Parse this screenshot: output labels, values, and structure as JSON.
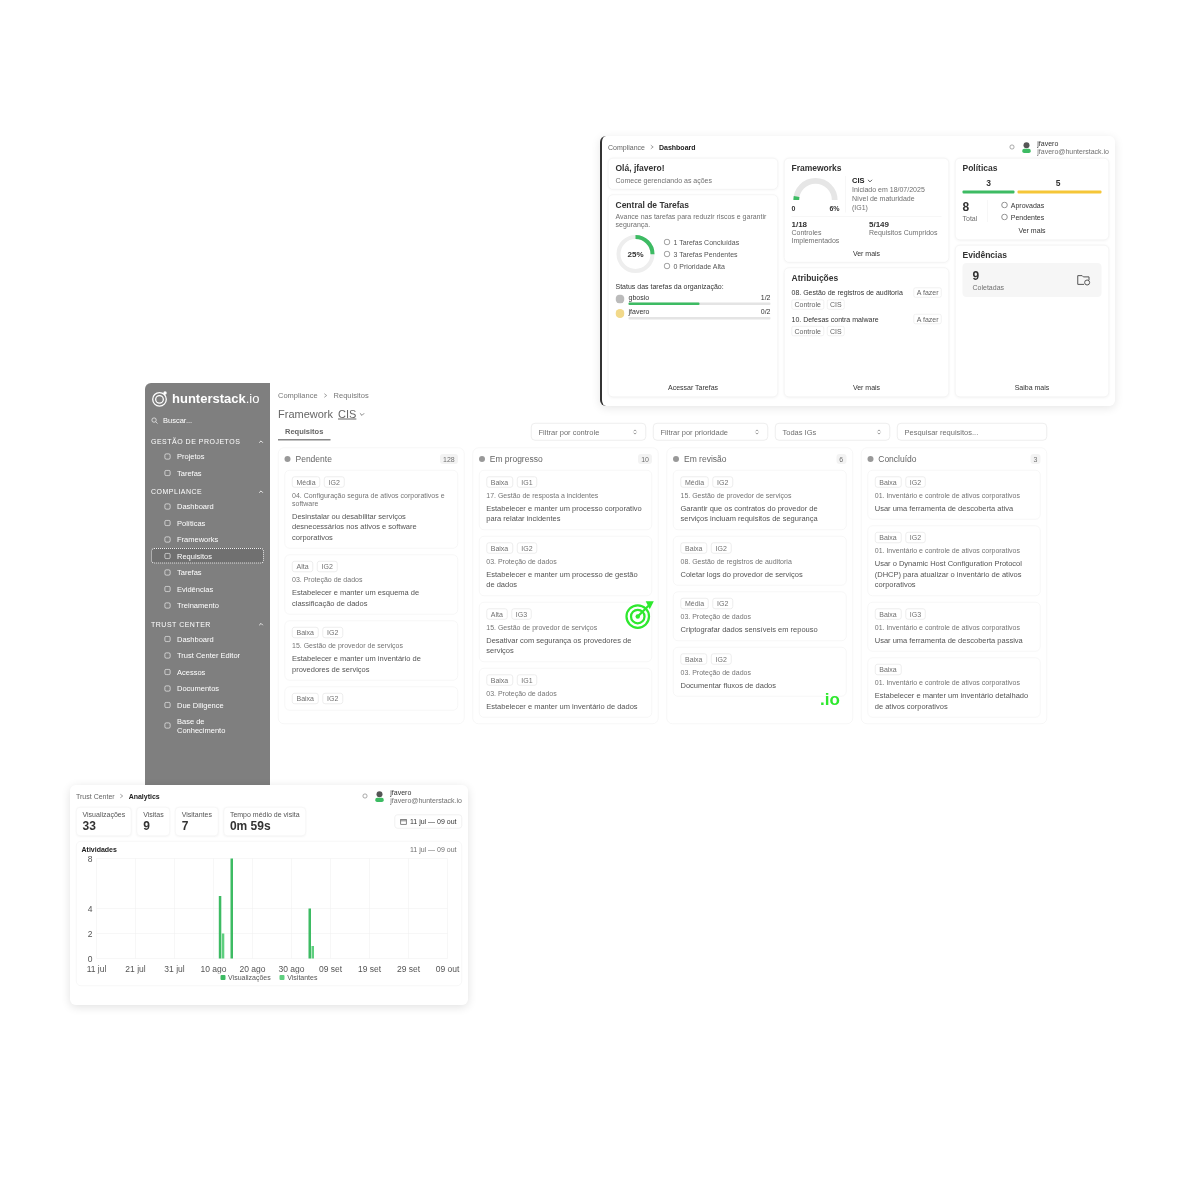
{
  "back_window": {
    "logo": {
      "name": "hunterstack",
      "suffix": ".io"
    },
    "search": {
      "placeholder": "Buscar..."
    },
    "sidebar": {
      "sections": [
        {
          "title": "GESTÃO DE PROJETOS",
          "expanded": true,
          "items": [
            {
              "label": "Projetos",
              "selected": false
            },
            {
              "label": "Tarefas",
              "selected": false
            }
          ]
        },
        {
          "title": "COMPLIANCE",
          "expanded": true,
          "items": [
            {
              "label": "Dashboard",
              "selected": false
            },
            {
              "label": "Políticas",
              "selected": false
            },
            {
              "label": "Frameworks",
              "selected": false
            },
            {
              "label": "Requisitos",
              "selected": true
            },
            {
              "label": "Tarefas",
              "selected": false
            },
            {
              "label": "Evidências",
              "selected": false
            },
            {
              "label": "Treinamento",
              "selected": false
            }
          ]
        },
        {
          "title": "TRUST CENTER",
          "expanded": true,
          "items": [
            {
              "label": "Dashboard",
              "selected": false
            },
            {
              "label": "Trust Center Editor",
              "selected": false
            },
            {
              "label": "Acessos",
              "selected": false
            },
            {
              "label": "Documentos",
              "selected": false
            },
            {
              "label": "Due Diligence",
              "selected": false
            },
            {
              "label": "Base de Conhecimento",
              "selected": false
            }
          ]
        }
      ]
    },
    "breadcrumb": [
      "Compliance",
      "Requisitos"
    ],
    "title": "Framework",
    "framework": "CIS",
    "tabs": [
      {
        "label": "Requisitos",
        "selected": true
      }
    ],
    "filters": [
      {
        "label": "Filtrar por controle",
        "kind": "select"
      },
      {
        "label": "Filtrar por prioridade",
        "kind": "select"
      },
      {
        "label": "Todas IGs",
        "kind": "select"
      },
      {
        "placeholder": "Pesquisar requisitos...",
        "kind": "search"
      }
    ],
    "columns": [
      {
        "name": "Pendente",
        "count": "128",
        "cards": [
          {
            "priority": "Média",
            "ig": "IG2",
            "category": "04. Configuração segura de ativos corporativos e software",
            "title": "Desinstalar ou desabilitar serviços desnecessários nos ativos e software corporativos"
          },
          {
            "priority": "Alta",
            "ig": "IG2",
            "category": "03. Proteção de dados",
            "title": "Estabelecer e manter um esquema de classificação de dados"
          },
          {
            "priority": "Baixa",
            "ig": "IG2",
            "category": "15. Gestão de provedor de serviços",
            "title": "Estabelecer e manter um inventário de provedores de serviços"
          },
          {
            "priority": "Baixa",
            "ig": "IG2"
          }
        ]
      },
      {
        "name": "Em progresso",
        "count": "10",
        "cards": [
          {
            "priority": "Baixa",
            "ig": "IG1",
            "category": "17. Gestão de resposta a incidentes",
            "title": "Estabelecer e manter um processo corporativo para relatar incidentes"
          },
          {
            "priority": "Baixa",
            "ig": "IG2",
            "category": "03. Proteção de dados",
            "title": "Estabelecer e manter um processo de gestão de dados"
          },
          {
            "priority": "Alta",
            "ig": "IG3",
            "category": "15. Gestão de provedor de serviços",
            "title": "Desativar com segurança os provedores de serviços"
          },
          {
            "priority": "Baixa",
            "ig": "IG1",
            "category": "03. Proteção de dados",
            "title": "Estabelecer e manter um inventário de dados"
          }
        ]
      },
      {
        "name": "Em revisão",
        "count": "6",
        "cards": [
          {
            "priority": "Média",
            "ig": "IG2",
            "category": "15. Gestão de provedor de serviços",
            "title": "Garantir que os contratos do provedor de serviços incluam requisitos de segurança"
          },
          {
            "priority": "Baixa",
            "ig": "IG2",
            "category": "08. Gestão de registros de auditoria",
            "title": "Coletar logs do provedor de serviços"
          },
          {
            "priority": "Média",
            "ig": "IG2",
            "category": "03. Proteção de dados",
            "title": "Criptografar dados sensíveis em repouso"
          },
          {
            "priority": "Baixa",
            "ig": "IG2",
            "category": "03. Proteção de dados",
            "title": "Documentar fluxos de dados"
          }
        ]
      },
      {
        "name": "Concluído",
        "count": "3",
        "cards": [
          {
            "priority": "Baixa",
            "ig": "IG2",
            "category": "01. Inventário e controle de ativos corporativos",
            "title": "Usar uma ferramenta de descoberta ativa"
          },
          {
            "priority": "Baixa",
            "ig": "IG2",
            "category": "01. Inventário e controle de ativos corporativos",
            "title": "Usar o Dynamic Host Configuration Protocol (DHCP) para atualizar o inventário de ativos corporativos"
          },
          {
            "priority": "Baixa",
            "ig": "IG3",
            "category": "01. Inventário e controle de ativos corporativos",
            "title": "Usar uma ferramenta de descoberta passiva"
          },
          {
            "priority": "Baixa",
            "category": "01. Inventário e controle de ativos corporativos",
            "title": "Estabelecer e manter um inventário detalhado de ativos corporativos"
          }
        ]
      }
    ]
  },
  "dashboard_window": {
    "breadcrumb": [
      "Compliance",
      "Dashboard"
    ],
    "user": {
      "name": "jfavero",
      "email": "jfavero@hunterstack.io"
    },
    "greeting": {
      "title": "Olá, jfavero!",
      "subtitle": "Comece gerenciando as ações"
    },
    "tasks": {
      "title": "Central de Tarefas",
      "subtitle": "Avance nas tarefas para reduzir riscos e garantir segurança.",
      "percent": "25%",
      "stats": [
        "1 Tarefas Concluídas",
        "3 Tarefas Pendentes",
        "0 Prioridade Alta"
      ],
      "status_title": "Status das tarefas da organização:",
      "people": [
        {
          "name": "gbosio",
          "value": "1/2",
          "level": 0.5
        },
        {
          "name": "jfavero",
          "value": "0/2",
          "level": 0
        }
      ],
      "link": "Acessar Tarefas"
    },
    "frameworks": {
      "title": "Frameworks",
      "gauge_min": "0",
      "gauge_value": "6%",
      "framework": "CIS",
      "started": "Iniciado em 18/07/2025",
      "maturity_label": "Nível de maturidade",
      "maturity": "(IG1)",
      "metrics": [
        {
          "value": "1/18",
          "label": "Controles Implementados"
        },
        {
          "value": "5/149",
          "label": "Requisitos Cumpridos"
        }
      ],
      "link": "Ver mais"
    },
    "assignments": {
      "title": "Atribuições",
      "items": [
        {
          "title": "08. Gestão de registros de auditoria",
          "tags": [
            "Controle",
            "CIS"
          ],
          "status": "A fazer"
        },
        {
          "title": "10. Defesas contra malware",
          "tags": [
            "Controle",
            "CIS"
          ],
          "status": "A fazer"
        }
      ],
      "link": "Ver mais"
    },
    "policies": {
      "title": "Políticas",
      "approved": "3",
      "pending": "5",
      "total": "8",
      "total_label": "Total",
      "legend": [
        "Aprovadas",
        "Pendentes"
      ],
      "link": "Ver mais"
    },
    "evidence": {
      "title": "Evidências",
      "count": "9",
      "label": "Coletadas",
      "link": "Saiba mais"
    }
  },
  "analytics_window": {
    "breadcrumb": [
      "Trust Center",
      "Analytics"
    ],
    "user": {
      "name": "jfavero",
      "email": "jfavero@hunterstack.io"
    },
    "stats": [
      {
        "label": "Visualizações",
        "value": "33"
      },
      {
        "label": "Visitas",
        "value": "9"
      },
      {
        "label": "Visitantes",
        "value": "7"
      },
      {
        "label": "Tempo médio de visita",
        "value": "0m 59s"
      }
    ],
    "date_range": "11 jul — 09 out",
    "chart": {
      "title": "Atividades",
      "range": "11 jul — 09 out",
      "chart_data": {
        "type": "bar",
        "categories": [
          "11 jul",
          null,
          null,
          null,
          null,
          null,
          null,
          null,
          null,
          null,
          "21 jul",
          null,
          null,
          null,
          null,
          null,
          null,
          null,
          null,
          null,
          "31 jul",
          null,
          null,
          null,
          null,
          null,
          null,
          null,
          null,
          null,
          "10 ago",
          null,
          null,
          null,
          null,
          null,
          null,
          null,
          null,
          null,
          "20 ago",
          null,
          null,
          null,
          null,
          null,
          null,
          null,
          null,
          null,
          "30 ago",
          null,
          null,
          null,
          null,
          null,
          null,
          null,
          null,
          null,
          "09 set",
          null,
          null,
          null,
          null,
          null,
          null,
          null,
          null,
          null,
          "19 set",
          null,
          null,
          null,
          null,
          null,
          null,
          null,
          null,
          null,
          "29 set",
          null,
          null,
          null,
          null,
          null,
          null,
          null,
          null,
          null,
          "09 out"
        ],
        "series": [
          {
            "name": "Visualizações",
            "color": "#3dbb63",
            "values": [
              null,
              null,
              null,
              null,
              null,
              null,
              null,
              null,
              null,
              null,
              null,
              null,
              null,
              null,
              null,
              null,
              null,
              null,
              null,
              null,
              null,
              null,
              null,
              null,
              null,
              null,
              null,
              null,
              null,
              null,
              null,
              null,
              5,
              null,
              null,
              8,
              null,
              null,
              null,
              null,
              null,
              null,
              null,
              null,
              null,
              null,
              null,
              null,
              null,
              null,
              null,
              null,
              null,
              null,
              null,
              4,
              null,
              null,
              null,
              null,
              null,
              null,
              null,
              null,
              null,
              null,
              null,
              null,
              null,
              null,
              null,
              null,
              null,
              null,
              null,
              null,
              null,
              null,
              null,
              null,
              null,
              null,
              null,
              null,
              null,
              null,
              null,
              null,
              null,
              null,
              null
            ]
          },
          {
            "name": "Visitantes",
            "color": "#5fcf7f",
            "values": [
              null,
              null,
              null,
              null,
              null,
              null,
              null,
              null,
              null,
              null,
              null,
              null,
              null,
              null,
              null,
              null,
              null,
              null,
              null,
              null,
              null,
              null,
              null,
              null,
              null,
              null,
              null,
              null,
              null,
              null,
              null,
              null,
              2,
              null,
              null,
              null,
              null,
              null,
              null,
              null,
              null,
              null,
              null,
              null,
              null,
              null,
              null,
              null,
              null,
              null,
              null,
              null,
              null,
              null,
              null,
              1,
              null,
              null,
              null,
              null,
              null,
              null,
              null,
              null,
              null,
              null,
              null,
              null,
              null,
              null,
              null,
              null,
              null,
              null,
              null,
              null,
              null,
              null,
              null,
              null,
              null,
              null,
              null,
              null,
              null,
              null,
              null,
              null,
              null,
              null,
              null
            ]
          }
        ],
        "ylim": [
          0,
          8
        ],
        "yticks": [
          0,
          2,
          4,
          8
        ],
        "grid": true
      }
    }
  },
  "overlay": {
    "suffix": ".io"
  }
}
